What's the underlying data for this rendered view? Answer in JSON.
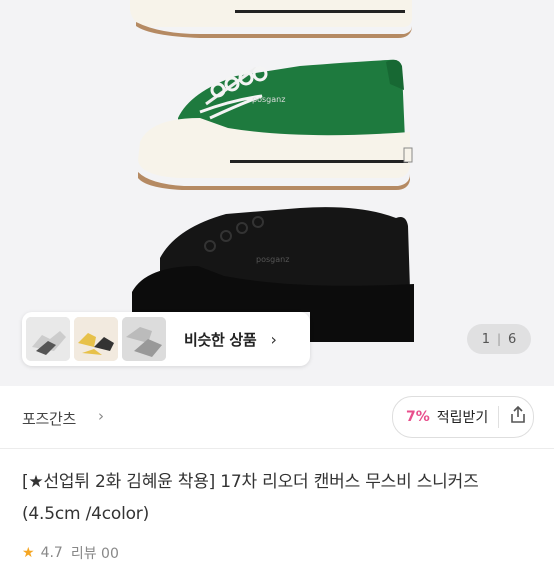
{
  "gallery": {
    "similar_products_label": "비슷한 상품",
    "chevron": "›",
    "counter_current": "1",
    "counter_total": "6"
  },
  "brand": {
    "name": "포즈간츠",
    "chevron": "›"
  },
  "reward": {
    "percent": "7%",
    "label": "적립받기"
  },
  "product": {
    "title": "[★선업튀 2화 김혜윤 착용] 17차 리오더 캔버스 무스비 스니커즈 (4.5cm /4color)"
  },
  "rating": {
    "star": "★",
    "score": "4.7",
    "review_text": "리뷰 00"
  },
  "colors": {
    "accent_pink": "#e84f8c",
    "green_shoe": "#1e7a3e",
    "black_shoe": "#111111"
  },
  "icons": [
    "chevron-right-icon",
    "share-icon",
    "star-icon"
  ]
}
